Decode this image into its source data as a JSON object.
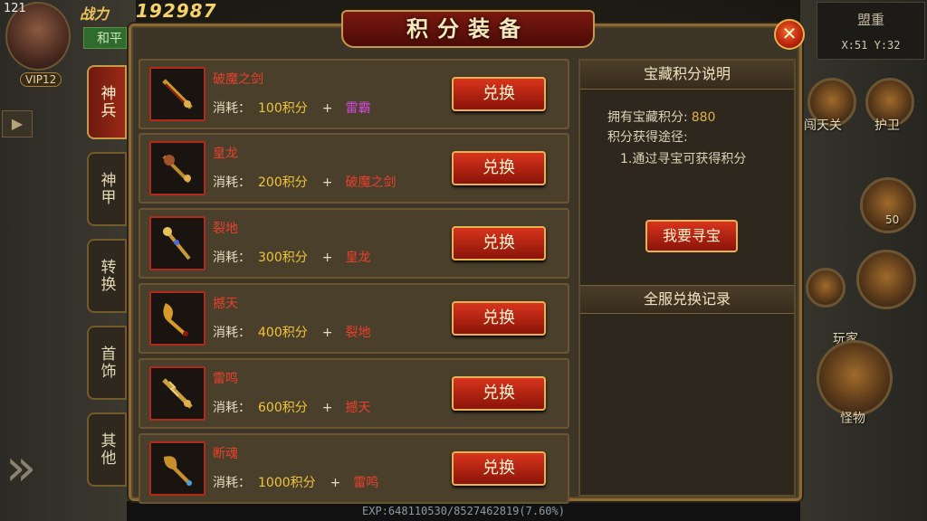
{
  "hud": {
    "level": "121",
    "power_label": "战力",
    "power_value": "192987",
    "mode": "和平",
    "vip": "VIP12",
    "team_title": "盟重",
    "coords": "X:51 Y:32",
    "exp": "EXP:648110530/8527462819(7.60%)",
    "skills": [
      {
        "label": "闯天关"
      },
      {
        "label": "护卫"
      },
      {
        "label": "50"
      },
      {
        "label": "玩家"
      },
      {
        "label": "怪物"
      }
    ]
  },
  "window": {
    "title": "积分装备",
    "close_icon": "close-x-icon"
  },
  "tabs": [
    {
      "label": "神兵",
      "active": true
    },
    {
      "label": "神甲",
      "active": false
    },
    {
      "label": "转换",
      "active": false
    },
    {
      "label": "首饰",
      "active": false
    },
    {
      "label": "其他",
      "active": false
    }
  ],
  "items": [
    {
      "name": "破魔之剑",
      "cost_label": "消耗：",
      "points": "100积分",
      "plus": "+",
      "requires": "雷霸",
      "requires_color": "#d24ad8",
      "button": "兑换",
      "icon": "sword-icon"
    },
    {
      "name": "皇龙",
      "cost_label": "消耗：",
      "points": "200积分",
      "plus": "+",
      "requires": "破魔之剑",
      "requires_color": "#e8402c",
      "button": "兑换",
      "icon": "dragon-sword-icon"
    },
    {
      "name": "裂地",
      "cost_label": "消耗：",
      "points": "300积分",
      "plus": "+",
      "requires": "皇龙",
      "requires_color": "#e8402c",
      "button": "兑换",
      "icon": "staff-icon"
    },
    {
      "name": "撼天",
      "cost_label": "消耗：",
      "points": "400积分",
      "plus": "+",
      "requires": "裂地",
      "requires_color": "#e8402c",
      "button": "兑换",
      "icon": "blade-icon"
    },
    {
      "name": "雷鸣",
      "cost_label": "消耗：",
      "points": "600积分",
      "plus": "+",
      "requires": "撼天",
      "requires_color": "#e8402c",
      "button": "兑换",
      "icon": "thunder-sword-icon"
    },
    {
      "name": "断魂",
      "cost_label": "消耗：",
      "points": "1000积分",
      "plus": "+",
      "requires": "雷鸣",
      "requires_color": "#e8402c",
      "button": "兑换",
      "icon": "soul-blade-icon"
    }
  ],
  "info": {
    "header": "宝藏积分说明",
    "points_label": "拥有宝藏积分:",
    "points_value": "880",
    "ways_label": "积分获得途径:",
    "way_1": "1.通过寻宝可获得积分",
    "treasure_button": "我要寻宝",
    "record_header": "全服兑换记录"
  },
  "colors": {
    "accent_red": "#d8341c",
    "gold_border": "#e6b354",
    "item_name": "#e8402c",
    "points": "#f0c43c",
    "require_special": "#d24ad8"
  }
}
